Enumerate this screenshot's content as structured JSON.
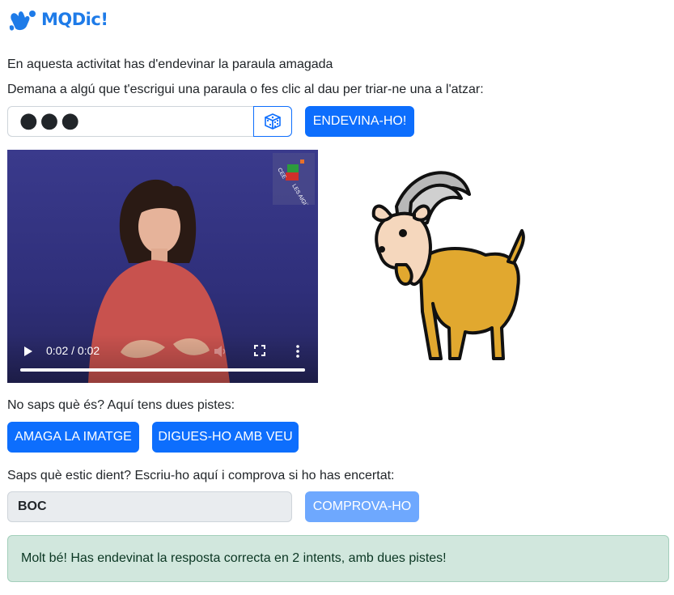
{
  "app": {
    "logo_text": "MQDic!"
  },
  "instructions": {
    "line1": "En aquesta activitat has d'endevinar la paraula amagada",
    "line2": "Demana a algú que t'escrigui una paraula o fes clic al dau per triar-ne una a l'atzar:"
  },
  "word_input": {
    "value": "●●●"
  },
  "buttons": {
    "guess": "ENDEVINA-HO!",
    "hide_image": "AMAGA LA IMATGE",
    "say_aloud": "DIGUES-HO AMB VEU",
    "check": "COMPROVA-HO"
  },
  "video": {
    "time": "0:02 / 0:02",
    "progress": 1.0,
    "watermark_left": "CEE",
    "watermark_right": "LES AIGÜES"
  },
  "image": {
    "icon": "goat-icon"
  },
  "hints": {
    "label": "No saps què és? Aquí tens dues pistes:"
  },
  "answer": {
    "prompt": "Saps què estic dient? Escriu-ho aquí i comprova si ho has encertat:",
    "value": "BOC"
  },
  "result": {
    "message": "Molt bé! Has endevinat la resposta correcta en 2 intents, amb dues pistes!"
  },
  "colors": {
    "primary": "#0d6efd",
    "success_bg": "#d1e7dd",
    "logo": "#1e7be8"
  }
}
